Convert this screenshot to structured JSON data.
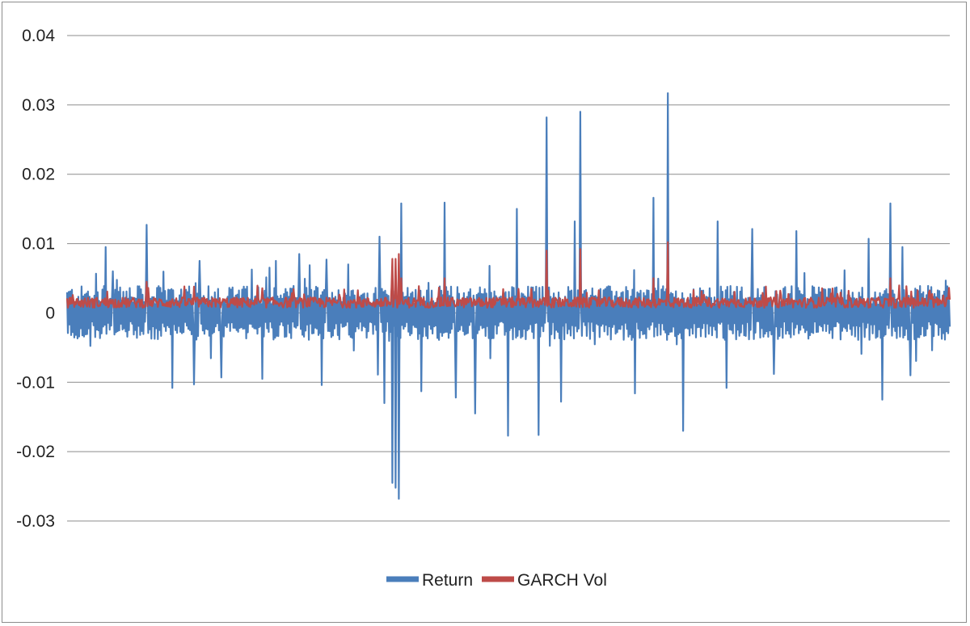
{
  "chart_data": {
    "type": "line",
    "title": "",
    "xlabel": "",
    "ylabel": "",
    "ylim": [
      -0.03,
      0.04
    ],
    "yticks": [
      "0.04",
      "0.03",
      "0.02",
      "0.01",
      "0",
      "-0.01",
      "-0.02",
      "-0.03"
    ],
    "ytick_values": [
      0.04,
      0.03,
      0.02,
      0.01,
      0,
      -0.01,
      -0.02,
      -0.03
    ],
    "grid": "horizontal",
    "legend_position": "bottom",
    "n_points": 1100,
    "series": [
      {
        "name": "Return",
        "color": "#4a7ebb",
        "baseline_amplitude": 0.003,
        "spikes": [
          {
            "i": 48,
            "v": 0.0095
          },
          {
            "i": 57,
            "v": 0.006
          },
          {
            "i": 99,
            "v": 0.0127
          },
          {
            "i": 131,
            "v": -0.0108
          },
          {
            "i": 165,
            "v": 0.0075
          },
          {
            "i": 158,
            "v": -0.0103
          },
          {
            "i": 192,
            "v": -0.0093
          },
          {
            "i": 243,
            "v": -0.0095
          },
          {
            "i": 260,
            "v": 0.0075
          },
          {
            "i": 289,
            "v": 0.0085
          },
          {
            "i": 317,
            "v": -0.0104
          },
          {
            "i": 323,
            "v": 0.0077
          },
          {
            "i": 350,
            "v": 0.007
          },
          {
            "i": 387,
            "v": -0.0089
          },
          {
            "i": 389,
            "v": 0.011
          },
          {
            "i": 395,
            "v": -0.013
          },
          {
            "i": 405,
            "v": -0.0245
          },
          {
            "i": 409,
            "v": -0.0252
          },
          {
            "i": 413,
            "v": -0.0268
          },
          {
            "i": 416,
            "v": 0.0158
          },
          {
            "i": 441,
            "v": -0.0113
          },
          {
            "i": 470,
            "v": 0.0159
          },
          {
            "i": 484,
            "v": -0.0122
          },
          {
            "i": 508,
            "v": -0.0145
          },
          {
            "i": 549,
            "v": -0.0177
          },
          {
            "i": 560,
            "v": 0.015
          },
          {
            "i": 587,
            "v": -0.0176
          },
          {
            "i": 597,
            "v": 0.0282
          },
          {
            "i": 615,
            "v": -0.0128
          },
          {
            "i": 632,
            "v": 0.0132
          },
          {
            "i": 639,
            "v": 0.029
          },
          {
            "i": 707,
            "v": -0.0116
          },
          {
            "i": 730,
            "v": 0.0166
          },
          {
            "i": 748,
            "v": 0.0317
          },
          {
            "i": 767,
            "v": -0.017
          },
          {
            "i": 810,
            "v": 0.0132
          },
          {
            "i": 821,
            "v": -0.0108
          },
          {
            "i": 853,
            "v": 0.0121
          },
          {
            "i": 880,
            "v": -0.0088
          },
          {
            "i": 908,
            "v": 0.0118
          },
          {
            "i": 998,
            "v": 0.0107
          },
          {
            "i": 1015,
            "v": -0.0125
          },
          {
            "i": 1025,
            "v": 0.0158
          },
          {
            "i": 1040,
            "v": 0.0095
          },
          {
            "i": 1050,
            "v": -0.009
          }
        ]
      },
      {
        "name": "GARCH Vol",
        "color": "#be4b48",
        "baseline": 0.0012,
        "spikes": [
          {
            "i": 99,
            "v": 0.0045
          },
          {
            "i": 405,
            "v": 0.0078
          },
          {
            "i": 409,
            "v": 0.0078
          },
          {
            "i": 413,
            "v": 0.0085
          },
          {
            "i": 416,
            "v": 0.005
          },
          {
            "i": 470,
            "v": 0.005
          },
          {
            "i": 597,
            "v": 0.009
          },
          {
            "i": 639,
            "v": 0.0092
          },
          {
            "i": 748,
            "v": 0.0102
          },
          {
            "i": 730,
            "v": 0.005
          },
          {
            "i": 1025,
            "v": 0.005
          }
        ]
      }
    ]
  }
}
